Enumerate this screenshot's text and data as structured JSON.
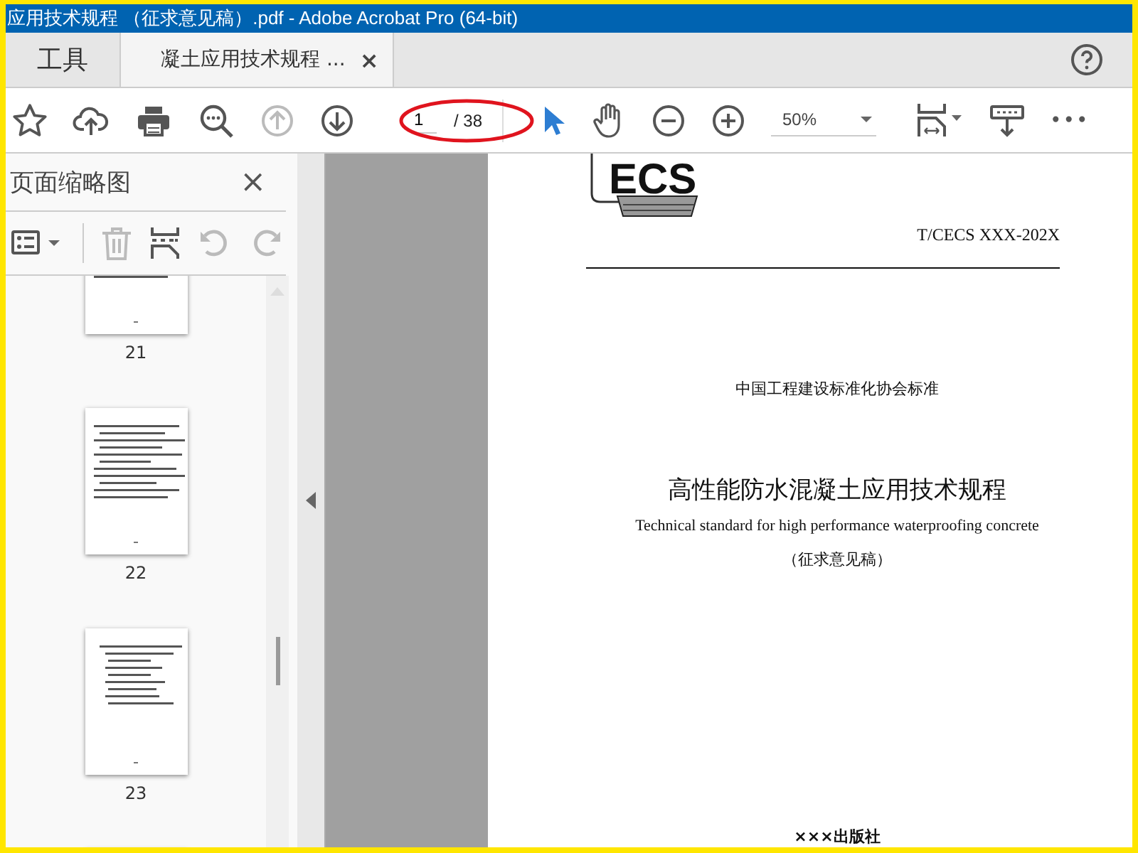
{
  "window": {
    "title": "应用技术规程 （征求意见稿）.pdf - Adobe Acrobat Pro (64-bit)"
  },
  "tabs": [
    {
      "label": "工具",
      "selected": false
    },
    {
      "label": "凝土应用技术规程 ...",
      "selected": true,
      "close": "×"
    }
  ],
  "toolbar": {
    "page_field": {
      "value": "1",
      "annotated": true
    },
    "page_total": "/ 38",
    "select_tool": {
      "selected": true
    },
    "zoom": {
      "value": "50%"
    },
    "more": "•••",
    "prev_page_disabled": true
  },
  "thumbnail_panel": {
    "title": "页面缩略图",
    "close": "×",
    "delete_disabled": true,
    "rotate_disabled": true,
    "thumbnails": [
      {
        "label": "21",
        "kind": "text"
      },
      {
        "label": "22",
        "kind": "text"
      },
      {
        "label": "23",
        "kind": "list"
      }
    ]
  },
  "page": {
    "logo_text": "ECS",
    "code": "T/CECS XXX-202X",
    "association": "中国工程建设标准化协会标准",
    "title": "高性能防水混凝土应用技术规程",
    "english_title": "Technical standard for high performance waterproofing concrete",
    "status": "（征求意见稿）",
    "publisher": "×××出版社"
  }
}
